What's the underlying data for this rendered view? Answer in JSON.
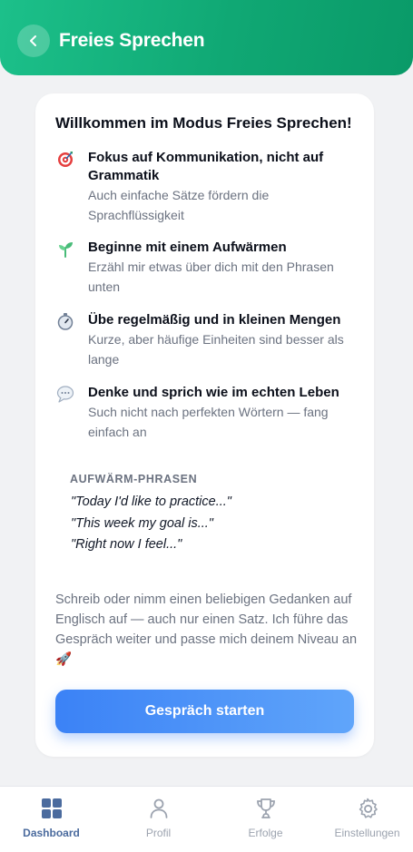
{
  "header": {
    "title": "Freies Sprechen",
    "accent_gradient": [
      "#1cc08a",
      "#0a9a68"
    ]
  },
  "card": {
    "title": "Willkommen im Modus Freies Sprechen!",
    "tips": [
      {
        "icon": "target-icon",
        "title": "Fokus auf Kommunikation, nicht auf Grammatik",
        "desc": "Auch einfache Sätze fördern die Sprachflüssigkeit"
      },
      {
        "icon": "seedling-icon",
        "title": "Beginne mit einem Aufwärmen",
        "desc": "Erzähl mir etwas über dich mit den Phrasen unten"
      },
      {
        "icon": "stopwatch-icon",
        "title": "Übe regelmäßig und in kleinen Mengen",
        "desc": "Kurze, aber häufige Einheiten sind besser als lange"
      },
      {
        "icon": "speech-bubble-icon",
        "title": "Denke und sprich wie im echten Leben",
        "desc": "Such nicht nach perfekten Wörtern — fang einfach an"
      }
    ],
    "phrases_label": "AUFWÄRM-PHRASEN",
    "phrases": [
      "\"Today I'd like to practice...\"",
      "\"This week my goal is...\"",
      "\"Right now I feel...\""
    ],
    "outro": "Schreib oder nimm einen beliebigen Gedanken auf Englisch auf — auch nur einen Satz. Ich führe das Gespräch weiter und passe mich deinem Niveau an 🚀",
    "start_button": "Gespräch starten",
    "button_color": "#3b82f6"
  },
  "nav": {
    "items": [
      {
        "label": "Dashboard",
        "icon": "dashboard-icon",
        "active": true
      },
      {
        "label": "Profil",
        "icon": "person-icon",
        "active": false
      },
      {
        "label": "Erfolge",
        "icon": "trophy-icon",
        "active": false
      },
      {
        "label": "Einstellungen",
        "icon": "gear-icon",
        "active": false
      }
    ],
    "active_color": "#4b6b9e"
  }
}
